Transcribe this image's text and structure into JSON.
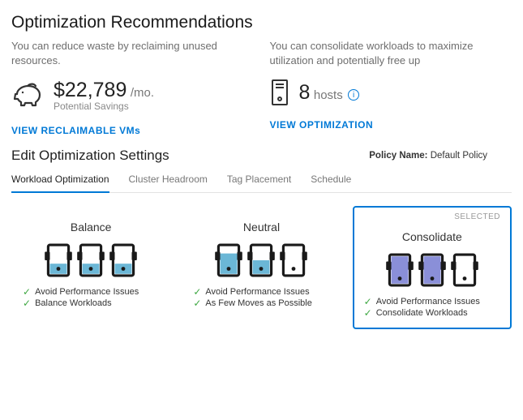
{
  "header": {
    "title": "Optimization Recommendations"
  },
  "reclaim": {
    "desc": "You can  reduce waste by reclaiming unused resources.",
    "value": "$22,789",
    "unit": "/mo.",
    "sub": "Potential Savings",
    "link": "VIEW RECLAIMABLE VMs"
  },
  "consolidate": {
    "desc": "You can consolidate workloads to maximize utilization and potentially free up",
    "value": "8",
    "unit": "hosts",
    "link": "VIEW OPTIMIZATION"
  },
  "settings": {
    "title": "Edit Optimization Settings",
    "policy_label": "Policy Name:",
    "policy_value": "Default Policy"
  },
  "tabs": {
    "workload": "Workload Optimization",
    "headroom": "Cluster Headroom",
    "tag": "Tag Placement",
    "schedule": "Schedule"
  },
  "options": {
    "selected_label": "SELECTED",
    "balance": {
      "title": "Balance",
      "b1": "Avoid Performance Issues",
      "b2": "Balance Workloads"
    },
    "neutral": {
      "title": "Neutral",
      "b1": "Avoid Performance Issues",
      "b2": "As Few Moves as Possible"
    },
    "consolidate": {
      "title": "Consolidate",
      "b1": "Avoid Performance Issues",
      "b2": "Consolidate Workloads"
    }
  }
}
